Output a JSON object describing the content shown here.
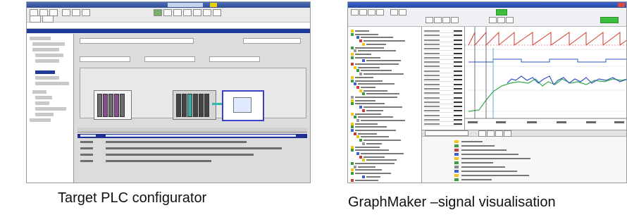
{
  "captions": {
    "left": "Target PLC configurator",
    "right": "GraphMaker –signal visualisation"
  },
  "colors": {
    "plc_selection": "#1f2f8f",
    "plc_titlebar": "#2f4d95",
    "gm_titlebar": "#2449a8",
    "gm_trace_red": "#d63b2f",
    "gm_trace_blue": "#2f56c8",
    "gm_trace_green": "#35a84a",
    "gm_status_green": "#3cbf3c"
  },
  "icons": {
    "plc_window_icon": "window-icon",
    "gm_close_icon": "close-icon"
  }
}
